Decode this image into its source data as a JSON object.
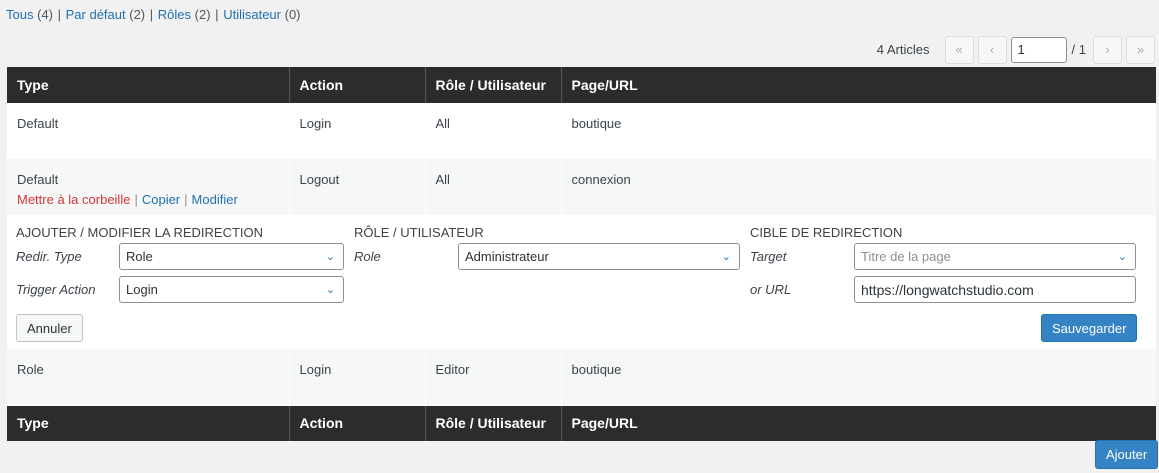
{
  "filters": [
    {
      "label": "Tous",
      "count": "(4)"
    },
    {
      "label": "Par défaut",
      "count": "(2)"
    },
    {
      "label": "Rôles",
      "count": "(2)"
    },
    {
      "label": "Utilisateur",
      "count": "(0)"
    }
  ],
  "pagination": {
    "displaying": "4 Articles",
    "first": "«",
    "prev": "‹",
    "current_page": "1",
    "total": "/ 1",
    "next": "›",
    "last": "»"
  },
  "columns": [
    "Type",
    "Action",
    "Rôle / Utilisateur",
    "Page/URL"
  ],
  "rows": [
    {
      "type": "Default",
      "action": "Login",
      "role": "All",
      "page": "boutique"
    },
    {
      "type": "Default",
      "action": "Logout",
      "role": "All",
      "page": "connexion",
      "row_actions": {
        "trash": "Mettre à la corbeille",
        "copy": "Copier",
        "edit": "Modifier"
      }
    },
    {
      "type": "Role",
      "action": "Login",
      "role": "Editor",
      "page": "boutique"
    }
  ],
  "edit_form": {
    "section_redirect": "AJOUTER / MODIFIER LA REDIRECTION",
    "section_role": "RÔLE / UTILISATEUR",
    "section_target": "CIBLE DE REDIRECTION",
    "redir_type_label": "Redir. Type",
    "redir_type_value": "Role",
    "trigger_action_label": "Trigger Action",
    "trigger_action_value": "Login",
    "role_label": "Role",
    "role_value": "Administrateur",
    "target_label": "Target",
    "target_placeholder": "Titre de la page",
    "url_label": "or URL",
    "url_value": "https://longwatchstudio.com",
    "cancel_label": "Annuler",
    "save_label": "Sauvegarder"
  },
  "add_label": "Ajouter"
}
